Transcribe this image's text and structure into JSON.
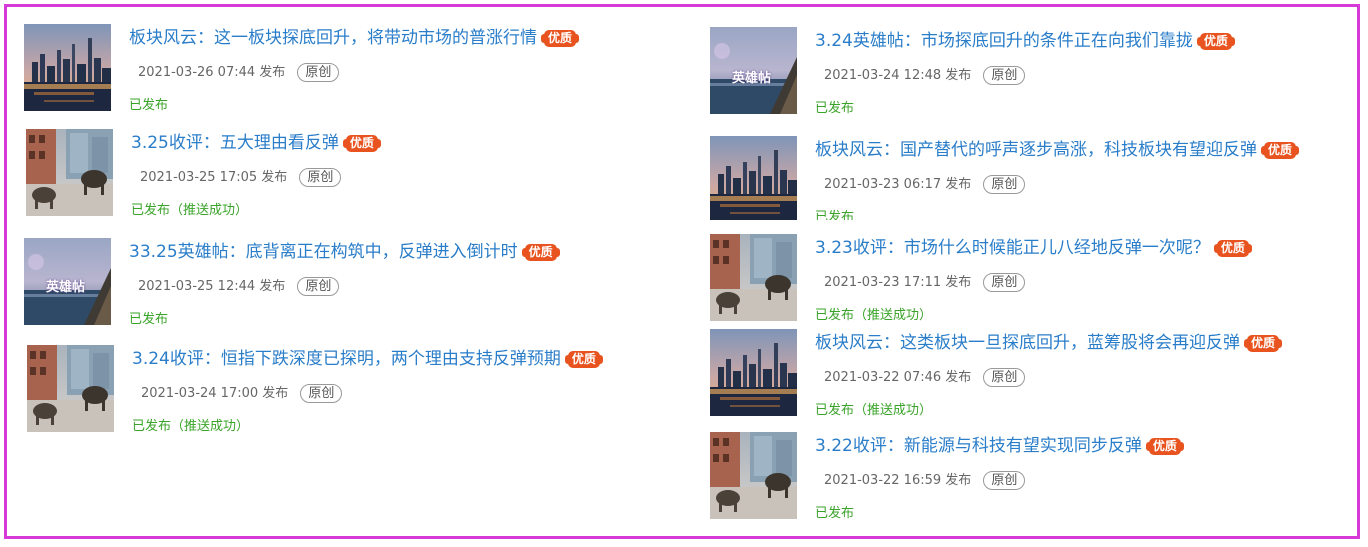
{
  "ui": {
    "verb": "发布",
    "original_tag": "原创",
    "badge": "优质"
  },
  "items": [
    {
      "title": "板块风云：这一板块探底回升，将带动市场的普涨行情",
      "date": "2021-03-26 07:44",
      "status": "已发布",
      "thumb": "city"
    },
    {
      "title": "3.25收评：五大理由看反弹",
      "date": "2021-03-25 17:05",
      "status": "已发布（推送成功）",
      "thumb": "bull"
    },
    {
      "title": "33.25英雄帖：底背离正在构筑中，反弹进入倒计时",
      "date": "2021-03-25 12:44",
      "status": "已发布",
      "thumb": "hero"
    },
    {
      "title": "3.24收评：恒指下跌深度已探明，两个理由支持反弹预期",
      "date": "2021-03-24 17:00",
      "status": "已发布（推送成功）",
      "thumb": "bull"
    },
    {
      "title": "3.24英雄帖：市场探底回升的条件正在向我们靠拢",
      "date": "2021-03-24 12:48",
      "status": "已发布",
      "thumb": "hero"
    },
    {
      "title": "板块风云：国产替代的呼声逐步高涨，科技板块有望迎反弹",
      "date": "2021-03-23 06:17",
      "status": "已发布",
      "thumb": "city"
    },
    {
      "title": "3.23收评：市场什么时候能正儿八经地反弹一次呢？",
      "date": "2021-03-23 17:11",
      "status": "已发布（推送成功）",
      "thumb": "bull"
    },
    {
      "title": "板块风云：这类板块一旦探底回升，蓝筹股将会再迎反弹",
      "date": "2021-03-22 07:46",
      "status": "已发布（推送成功）",
      "thumb": "city"
    },
    {
      "title": "3.22收评：新能源与科技有望实现同步反弹",
      "date": "2021-03-22 16:59",
      "status": "已发布",
      "thumb": "bull"
    }
  ],
  "hero_thumb_text": "英雄帖",
  "colors": {
    "border": "#d63bd8",
    "title": "#2a7dc9",
    "status": "#3aa329",
    "badge": "#e8531f"
  }
}
